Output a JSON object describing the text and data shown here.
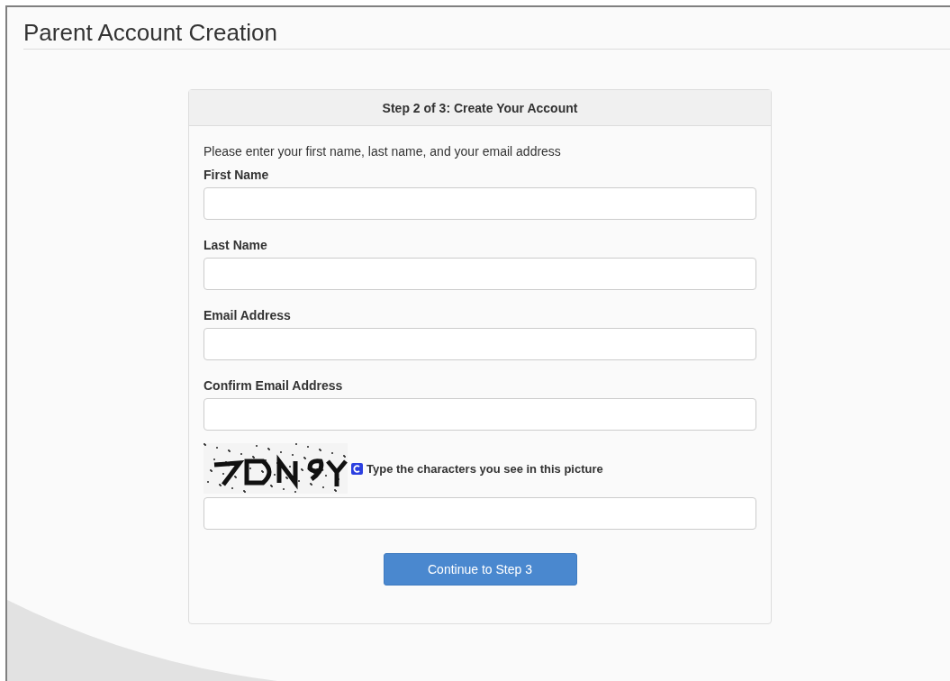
{
  "page": {
    "title": "Parent Account Creation"
  },
  "card": {
    "heading": "Step 2 of 3: Create Your Account",
    "instructions": "Please enter your first name, last name, and your email address",
    "fields": [
      {
        "label": "First Name"
      },
      {
        "label": "Last Name"
      },
      {
        "label": "Email Address"
      },
      {
        "label": "Confirm Email Address"
      }
    ],
    "captcha": {
      "prompt": "Type the characters you see in this picture"
    },
    "button": "Continue to Step 3"
  }
}
